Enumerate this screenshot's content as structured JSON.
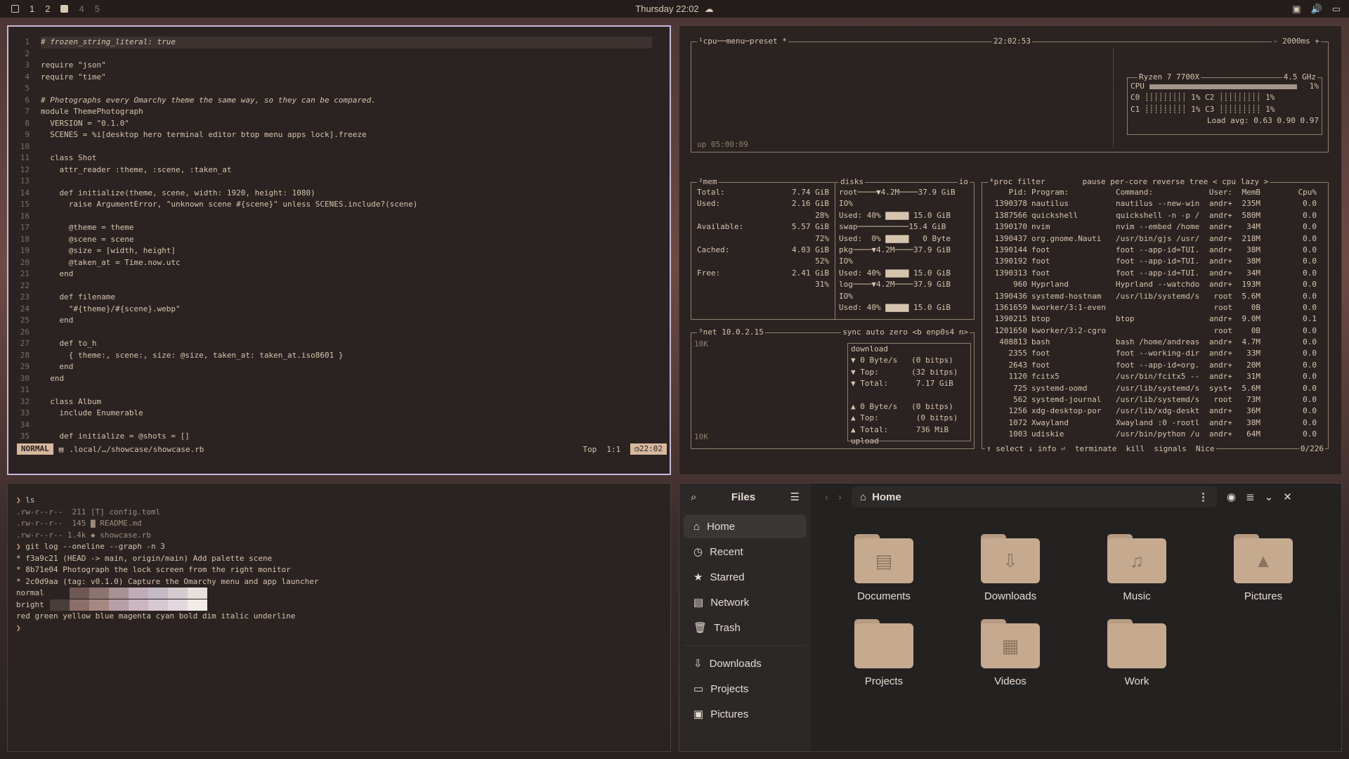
{
  "topbar": {
    "workspaces": [
      "1",
      "2",
      "4",
      "5"
    ],
    "clock": "Thursday 22:02"
  },
  "editor": {
    "lines": [
      {
        "n": "1",
        "t": "# frozen_string_literal: true"
      },
      {
        "n": "2",
        "t": ""
      },
      {
        "n": "3",
        "t": "require \"json\""
      },
      {
        "n": "4",
        "t": "require \"time\""
      },
      {
        "n": "5",
        "t": ""
      },
      {
        "n": "6",
        "t": "# Photographs every Omarchy theme the same way, so they can be compared."
      },
      {
        "n": "7",
        "t": "module ThemePhotograph"
      },
      {
        "n": "8",
        "t": "  VERSION = \"0.1.0\""
      },
      {
        "n": "9",
        "t": "  SCENES = %i[desktop hero terminal editor btop menu apps lock].freeze"
      },
      {
        "n": "10",
        "t": ""
      },
      {
        "n": "11",
        "t": "  class Shot"
      },
      {
        "n": "12",
        "t": "    attr_reader :theme, :scene, :taken_at"
      },
      {
        "n": "13",
        "t": ""
      },
      {
        "n": "14",
        "t": "    def initialize(theme, scene, width: 1920, height: 1080)"
      },
      {
        "n": "15",
        "t": "      raise ArgumentError, \"unknown scene #{scene}\" unless SCENES.include?(scene)"
      },
      {
        "n": "16",
        "t": ""
      },
      {
        "n": "17",
        "t": "      @theme = theme"
      },
      {
        "n": "18",
        "t": "      @scene = scene"
      },
      {
        "n": "19",
        "t": "      @size = [width, height]"
      },
      {
        "n": "20",
        "t": "      @taken_at = Time.now.utc"
      },
      {
        "n": "21",
        "t": "    end"
      },
      {
        "n": "22",
        "t": ""
      },
      {
        "n": "23",
        "t": "    def filename"
      },
      {
        "n": "24",
        "t": "      \"#{theme}/#{scene}.webp\""
      },
      {
        "n": "25",
        "t": "    end"
      },
      {
        "n": "26",
        "t": ""
      },
      {
        "n": "27",
        "t": "    def to_h"
      },
      {
        "n": "28",
        "t": "      { theme:, scene:, size: @size, taken_at: taken_at.iso8601 }"
      },
      {
        "n": "29",
        "t": "    end"
      },
      {
        "n": "30",
        "t": "  end"
      },
      {
        "n": "31",
        "t": ""
      },
      {
        "n": "32",
        "t": "  class Album"
      },
      {
        "n": "33",
        "t": "    include Enumerable"
      },
      {
        "n": "34",
        "t": ""
      },
      {
        "n": "35",
        "t": "    def initialize = @shots = []"
      }
    ],
    "mode": "NORMAL",
    "file": ".local/…/showcase/showcase.rb",
    "pos": "Top",
    "cursor": "1:1",
    "time": "22:02"
  },
  "btop": {
    "cpu_title": "¹cpu",
    "menu": "menu",
    "preset": "preset *",
    "time": "22:02:53",
    "interval": "- 2000ms +",
    "cpu_model": "Ryzen 7 7700X",
    "freq": "4.5 GHz",
    "uptime": "up 05:00:09",
    "cpu_rows": [
      "CPU",
      "C0",
      "C1",
      "C2",
      "C3"
    ],
    "cpu_pct": "1%",
    "load": "Load avg: 0.63 0.90 0.97",
    "mem_title": "²mem",
    "disks_title": "disks",
    "io": "io",
    "mem": [
      {
        "k": "Total:",
        "v": "7.74 GiB"
      },
      {
        "k": "Used:",
        "v": "2.16 GiB"
      },
      {
        "k": "",
        "v": "28%"
      },
      {
        "k": "Available:",
        "v": "5.57 GiB"
      },
      {
        "k": "",
        "v": "72%"
      },
      {
        "k": "Cached:",
        "v": "4.03 GiB"
      },
      {
        "k": "",
        "v": "52%"
      },
      {
        "k": "Free:",
        "v": "2.41 GiB"
      },
      {
        "k": "",
        "v": "31%"
      }
    ],
    "disks": [
      "root────▼4.2M────37.9 GiB",
      "IO%",
      "Used: 40% ▇▇▇▇▇ 15.0 GiB",
      "swap───────────15.4 GiB",
      "Used:  0% ▇▇▇▇▇   0 Byte",
      "pkg────▼4.2M────37.9 GiB",
      "IO%",
      "Used: 40% ▇▇▇▇▇ 15.0 GiB",
      "log────▼4.2M────37.9 GiB",
      "IO%",
      "Used: 40% ▇▇▇▇▇ 15.0 GiB"
    ],
    "net_title": "³net",
    "ip": "10.0.2.15",
    "net_opts": "sync auto zero <b enp0s4 n>",
    "net_scale": "10K",
    "net": [
      "download",
      "▼ 0 Byte/s   (0 bitps)",
      "▼ Top:       (32 bitps)",
      "▼ Total:      7.17 GiB",
      "",
      "▲ 0 Byte/s   (0 bitps)",
      "▲ Top:        (0 bitps)",
      "▲ Total:      736 MiB",
      "upload"
    ],
    "proc_title": "⁴proc",
    "proc_opts": "filter        pause per-core reverse tree < cpu lazy >",
    "proc_header": {
      "pid": "Pid:",
      "prog": "Program:",
      "cmd": "Command:",
      "user": "User:",
      "mem": "MemB",
      "cpu": "Cpu%"
    },
    "procs": [
      [
        "1390378",
        "nautilus",
        "nautilus --new-win",
        "andr+",
        "235M",
        "0.0"
      ],
      [
        "1387566",
        "quickshell",
        "quickshell -n -p /",
        "andr+",
        "580M",
        "0.0"
      ],
      [
        "1390170",
        "nvim",
        "nvim --embed /home",
        "andr+",
        "34M",
        "0.0"
      ],
      [
        "1390437",
        "org.gnome.Nauti",
        "/usr/bin/gjs /usr/",
        "andr+",
        "218M",
        "0.0"
      ],
      [
        "1390144",
        "foot",
        "foot --app-id=TUI.",
        "andr+",
        "38M",
        "0.0"
      ],
      [
        "1390192",
        "foot",
        "foot --app-id=TUI.",
        "andr+",
        "38M",
        "0.0"
      ],
      [
        "1390313",
        "foot",
        "foot --app-id=TUI.",
        "andr+",
        "34M",
        "0.0"
      ],
      [
        "960",
        "Hyprland",
        "Hyprland --watchdo",
        "andr+",
        "193M",
        "0.0"
      ],
      [
        "1390436",
        "systemd-hostnam",
        "/usr/lib/systemd/s",
        "root",
        "5.6M",
        "0.0"
      ],
      [
        "1361659",
        "kworker/3:1-even",
        "",
        "root",
        "0B",
        "0.0"
      ],
      [
        "1390215",
        "btop",
        "btop",
        "andr+",
        "9.0M",
        "0.1"
      ],
      [
        "1201650",
        "kworker/3:2-cgro",
        "",
        "root",
        "0B",
        "0.0"
      ],
      [
        "408813",
        "bash",
        "bash /home/andreas",
        "andr+",
        "4.7M",
        "0.0"
      ],
      [
        "2355",
        "foot",
        "foot --working-dir",
        "andr+",
        "33M",
        "0.0"
      ],
      [
        "2643",
        "foot",
        "foot --app-id=org.",
        "andr+",
        "20M",
        "0.0"
      ],
      [
        "1120",
        "fcitx5",
        "/usr/bin/fcitx5 --",
        "andr+",
        "31M",
        "0.0"
      ],
      [
        "725",
        "systemd-oomd",
        "/usr/lib/systemd/s",
        "syst+",
        "5.6M",
        "0.0"
      ],
      [
        "562",
        "systemd-journal",
        "/usr/lib/systemd/s",
        "root",
        "73M",
        "0.0"
      ],
      [
        "1256",
        "xdg-desktop-por",
        "/usr/lib/xdg-deskt",
        "andr+",
        "36M",
        "0.0"
      ],
      [
        "1072",
        "Xwayland",
        "Xwayland :0 -rootl",
        "andr+",
        "38M",
        "0.0"
      ],
      [
        "1003",
        "udiskie",
        "/usr/bin/python /u",
        "andr+",
        "64M",
        "0.0"
      ]
    ],
    "proc_foot": "↑ select ↓ info ⏎  terminate  kill  signals  Nice",
    "proc_count": "0/226"
  },
  "terminal": {
    "lines": [
      {
        "p": "❯ ",
        "t": "ls"
      },
      {
        "p": "",
        "t": ".rw-r--r--  211 [T] config.toml"
      },
      {
        "p": "",
        "t": ".rw-r--r--  145 ▇ README.md"
      },
      {
        "p": "",
        "t": ".rw-r--r-- 1.4k ◆ showcase.rb"
      },
      {
        "p": "❯ ",
        "t": "git log --oneline --graph -n 3"
      },
      {
        "p": "",
        "t": "* f3a9c21 (HEAD -> main, origin/main) Add palette scene"
      },
      {
        "p": "",
        "t": "* 8b71e04 Photograph the lock screen from the right monitor"
      },
      {
        "p": "",
        "t": "* 2c0d9aa (tag: v0.1.0) Capture the Omarchy menu and app launcher"
      },
      {
        "p": "",
        "t": "normal"
      },
      {
        "p": "",
        "t": "bright"
      },
      {
        "p": "",
        "t": "red green yellow blue magenta cyan bold dim italic underline"
      },
      {
        "p": "❯",
        "t": ""
      }
    ],
    "palette_normal": [
      "#2b2321",
      "#6e5854",
      "#8d7470",
      "#a79195",
      "#c2abb8",
      "#c6b9c6",
      "#d5cad0",
      "#e8e0dc"
    ],
    "palette_bright": [
      "#4a3e3a",
      "#8c6e68",
      "#a78880",
      "#b8a0a8",
      "#ccb6c2",
      "#d8c8d2",
      "#e2d8dc",
      "#f2ece8"
    ]
  },
  "files": {
    "title": "Files",
    "nav": [
      "Home",
      "Recent",
      "Starred",
      "Network",
      "Trash"
    ],
    "bookmarks": [
      "Downloads",
      "Projects",
      "Pictures"
    ],
    "path": "Home",
    "items": [
      {
        "name": "Documents",
        "icon": "document-icon"
      },
      {
        "name": "Downloads",
        "icon": "download-icon"
      },
      {
        "name": "Music",
        "icon": "music-icon"
      },
      {
        "name": "Pictures",
        "icon": "pictures-icon"
      },
      {
        "name": "Projects",
        "icon": "folder-icon"
      },
      {
        "name": "Videos",
        "icon": "video-icon"
      },
      {
        "name": "Work",
        "icon": "folder-icon"
      }
    ]
  }
}
